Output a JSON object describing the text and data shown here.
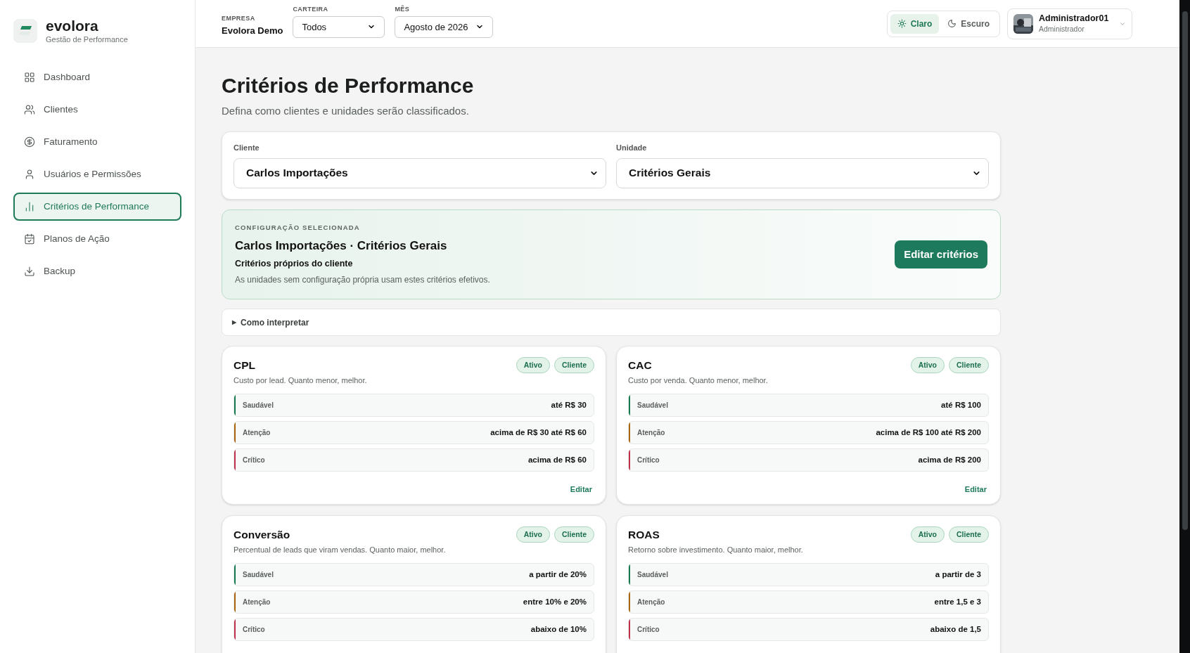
{
  "brand": {
    "name": "evolora",
    "tagline": "Gestão de Performance"
  },
  "sidebar": {
    "items": [
      {
        "label": "Dashboard",
        "selected": false
      },
      {
        "label": "Clientes",
        "selected": false
      },
      {
        "label": "Faturamento",
        "selected": false
      },
      {
        "label": "Usuários e Permissões",
        "selected": false
      },
      {
        "label": "Critérios de Performance",
        "selected": true
      },
      {
        "label": "Planos de Ação",
        "selected": false
      },
      {
        "label": "Backup",
        "selected": false
      }
    ]
  },
  "header": {
    "empresa": {
      "label": "EMPRESA",
      "value": "Evolora Demo"
    },
    "carteira": {
      "label": "CARTEIRA",
      "value": "Todos"
    },
    "mes": {
      "label": "MÊS",
      "value": "Agosto de 2026"
    },
    "theme": [
      {
        "label": "Claro",
        "selected": true
      },
      {
        "label": "Escuro",
        "selected": false
      }
    ],
    "user": {
      "name": "Administrador01",
      "role": "Administrador"
    }
  },
  "page": {
    "title": "Critérios de Performance",
    "subtitle": "Defina como clientes e unidades serão classificados."
  },
  "filters": [
    {
      "label": "Cliente",
      "value": "Carlos Importações"
    },
    {
      "label": "Unidade",
      "value": "Critérios Gerais"
    }
  ],
  "config": {
    "eyebrow": "CONFIGURAÇÃO SELECIONADA",
    "title": "Carlos Importações · Critérios Gerais",
    "subtitle": "Critérios próprios do cliente",
    "note": "As unidades sem configuração própria usam estes critérios efetivos.",
    "button": "Editar critérios"
  },
  "disclosure": {
    "marker": "▶",
    "label": "Como interpretar",
    "expanded": false
  },
  "metrics": [
    {
      "name": "CPL",
      "description": "Custo por lead. Quanto menor, melhor.",
      "badges": [
        "Ativo",
        "Cliente"
      ],
      "levels": [
        {
          "label": "Saudável",
          "value": "até R$ 30",
          "color": "#15794f"
        },
        {
          "label": "Atenção",
          "value": "acima de R$ 30 até R$ 60",
          "color": "#a8650c"
        },
        {
          "label": "Crítico",
          "value": "acima de R$ 60",
          "color": "#c0304a"
        }
      ],
      "edit": "Editar"
    },
    {
      "name": "CAC",
      "description": "Custo por venda. Quanto menor, melhor.",
      "badges": [
        "Ativo",
        "Cliente"
      ],
      "levels": [
        {
          "label": "Saudável",
          "value": "até R$ 100",
          "color": "#15794f"
        },
        {
          "label": "Atenção",
          "value": "acima de R$ 100 até R$ 200",
          "color": "#a8650c"
        },
        {
          "label": "Crítico",
          "value": "acima de R$ 200",
          "color": "#c0304a"
        }
      ],
      "edit": "Editar"
    },
    {
      "name": "Conversão",
      "description": "Percentual de leads que viram vendas. Quanto maior, melhor.",
      "badges": [
        "Ativo",
        "Cliente"
      ],
      "levels": [
        {
          "label": "Saudável",
          "value": "a partir de 20%",
          "color": "#15794f"
        },
        {
          "label": "Atenção",
          "value": "entre 10% e 20%",
          "color": "#a8650c"
        },
        {
          "label": "Crítico",
          "value": "abaixo de 10%",
          "color": "#c0304a"
        }
      ]
    },
    {
      "name": "ROAS",
      "description": "Retorno sobre investimento. Quanto maior, melhor.",
      "badges": [
        "Ativo",
        "Cliente"
      ],
      "levels": [
        {
          "label": "Saudável",
          "value": "a partir de 3",
          "color": "#15794f"
        },
        {
          "label": "Atenção",
          "value": "entre 1,5 e 3",
          "color": "#a8650c"
        },
        {
          "label": "Crítico",
          "value": "abaixo de 1,5",
          "color": "#c0304a"
        }
      ]
    }
  ]
}
